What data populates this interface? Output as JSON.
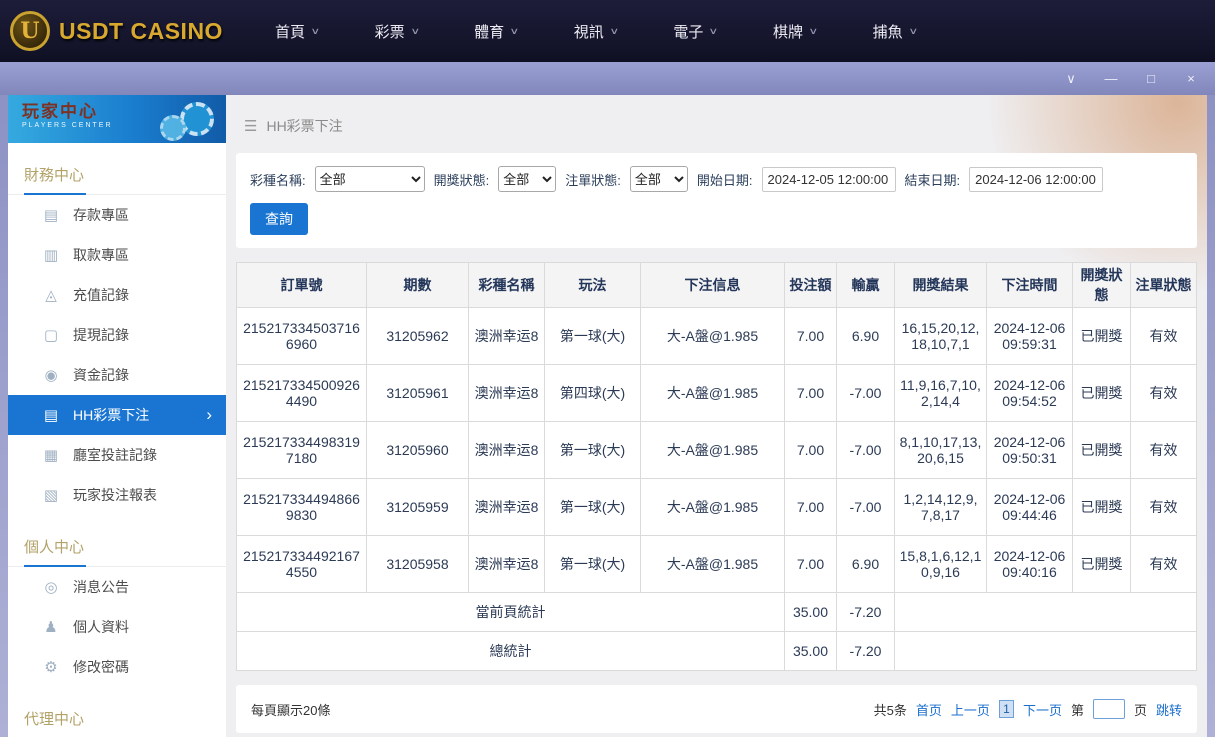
{
  "colors": {
    "accent_blue": "#1a75d2",
    "logo_gold": "#d9a82f",
    "titlebar_purple": "#8b90c4",
    "link_blue": "#1a6ecc",
    "topbar_dark": "#14142c"
  },
  "topnav": {
    "logo_letter": "U",
    "logo_text": "USDT CASINO",
    "chevron": "∨",
    "items": [
      {
        "label": "首頁"
      },
      {
        "label": "彩票"
      },
      {
        "label": "體育"
      },
      {
        "label": "視訊"
      },
      {
        "label": "電子"
      },
      {
        "label": "棋牌"
      },
      {
        "label": "捕魚"
      }
    ]
  },
  "titlebar": {
    "controls": [
      {
        "name": "dropdown",
        "glyph": "∨"
      },
      {
        "name": "minimize",
        "glyph": "—"
      },
      {
        "name": "maximize",
        "glyph": "□"
      },
      {
        "name": "close",
        "glyph": "×"
      }
    ]
  },
  "sidebar": {
    "header": {
      "title": "玩家中心",
      "subtitle": "PLAYERS CENTER"
    },
    "sections": [
      {
        "label": "財務中心",
        "items": [
          {
            "label": "存款專區",
            "icon": "deposit",
            "glyph": "▤"
          },
          {
            "label": "取款專區",
            "icon": "withdraw",
            "glyph": "▥"
          },
          {
            "label": "充值記錄",
            "icon": "recharge-record",
            "glyph": "◬"
          },
          {
            "label": "提現記錄",
            "icon": "withdrawal-record",
            "glyph": "▢"
          },
          {
            "label": "資金記錄",
            "icon": "funds-record",
            "glyph": "◉"
          },
          {
            "label": "HH彩票下注",
            "icon": "hh-lottery-bet",
            "glyph": "▤",
            "active": true
          },
          {
            "label": "廳室投註記錄",
            "icon": "hall-bet-record",
            "glyph": "▦"
          },
          {
            "label": "玩家投注報表",
            "icon": "player-bet-report",
            "glyph": "▧"
          }
        ]
      },
      {
        "label": "個人中心",
        "items": [
          {
            "label": "消息公告",
            "icon": "message",
            "glyph": "◎"
          },
          {
            "label": "個人資料",
            "icon": "profile",
            "glyph": "♟"
          },
          {
            "label": "修改密碼",
            "icon": "password",
            "glyph": "⚙"
          }
        ]
      },
      {
        "label": "代理中心",
        "items": []
      }
    ]
  },
  "breadcrumb": {
    "menu_icon": "☰",
    "title": "HH彩票下注"
  },
  "filters": {
    "lottery_label": "彩種名稱:",
    "lottery_value": "全部",
    "draw_status_label": "開獎狀態:",
    "draw_status_value": "全部",
    "order_status_label": "注單狀態:",
    "order_status_value": "全部",
    "start_label": "開始日期:",
    "start_value": "2024-12-05 12:00:00",
    "end_label": "結束日期:",
    "end_value": "2024-12-06 12:00:00",
    "search_button": "查詢"
  },
  "table": {
    "headers": [
      "訂單號",
      "期數",
      "彩種名稱",
      "玩法",
      "下注信息",
      "投注額",
      "輸贏",
      "開獎結果",
      "下注時間",
      "開獎狀態",
      "注單狀態"
    ],
    "rows": [
      [
        "2152173345037166960",
        "31205962",
        "澳洲幸运8",
        "第一球(大)",
        "大-A盤@1.985",
        "7.00",
        "6.90",
        "16,15,20,12,18,10,7,1",
        "2024-12-06 09:59:31",
        "已開獎",
        "有效"
      ],
      [
        "2152173345009264490",
        "31205961",
        "澳洲幸运8",
        "第四球(大)",
        "大-A盤@1.985",
        "7.00",
        "-7.00",
        "11,9,16,7,10,2,14,4",
        "2024-12-06 09:54:52",
        "已開獎",
        "有效"
      ],
      [
        "2152173344983197180",
        "31205960",
        "澳洲幸运8",
        "第一球(大)",
        "大-A盤@1.985",
        "7.00",
        "-7.00",
        "8,1,10,17,13,20,6,15",
        "2024-12-06 09:50:31",
        "已開獎",
        "有效"
      ],
      [
        "2152173344948669830",
        "31205959",
        "澳洲幸运8",
        "第一球(大)",
        "大-A盤@1.985",
        "7.00",
        "-7.00",
        "1,2,14,12,9,7,8,17",
        "2024-12-06 09:44:46",
        "已開獎",
        "有效"
      ],
      [
        "2152173344921674550",
        "31205958",
        "澳洲幸运8",
        "第一球(大)",
        "大-A盤@1.985",
        "7.00",
        "6.90",
        "15,8,1,6,12,10,9,16",
        "2024-12-06 09:40:16",
        "已開獎",
        "有效"
      ]
    ],
    "summary": [
      {
        "label": "當前頁統計",
        "bet_total": "35.00",
        "win_loss_total": "-7.20"
      },
      {
        "label": "總統計",
        "bet_total": "35.00",
        "win_loss_total": "-7.20"
      }
    ]
  },
  "pagination": {
    "page_size_text": "每頁顯示20條",
    "total_text": "共5条",
    "first_label": "首页",
    "prev_label": "上一页",
    "current_page": "1",
    "next_label": "下一页",
    "jump_prefix": "第",
    "jump_suffix": "页",
    "jump_label": "跳转",
    "jump_value": ""
  }
}
